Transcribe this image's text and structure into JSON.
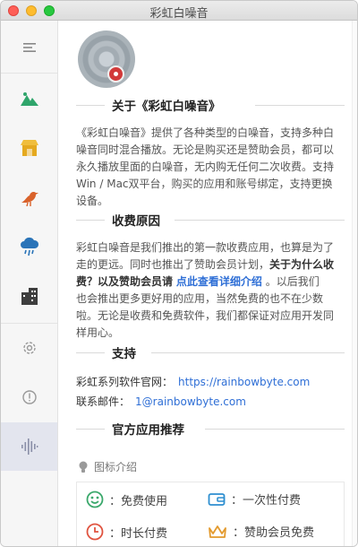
{
  "window": {
    "title": "彩虹白噪音"
  },
  "about": {
    "title": "关于《彩虹白噪音》",
    "lines": [
      "《彩虹白噪音》提供了各种类型的白噪音，支持多种白",
      "噪音同时混合播放。无论是购买还是赞助会员，都可以",
      "永久播放里面的白噪音，无内购无任何二次收费。支持",
      "Win / Mac双平台，购买的应用和账号绑定，支持更换",
      "设备。"
    ]
  },
  "reason": {
    "title": "收费原因",
    "line1": "彩虹白噪音是我们推出的第一款收费应用，也算是为了",
    "line2a": "走的更远。同时也推出了赞助会员计划，",
    "line2b": "关于为什么收",
    "line3a": "费？以及赞助会员请",
    "line3link": "点此查看详细介绍",
    "line3b": "。以后我们",
    "line4": "也会推出更多更好用的应用，当然免费的也不在少数",
    "line5": "啦。无论是收费和免费软件，我们都保证对应用开发同",
    "line6": "样用心。"
  },
  "support": {
    "title": "支持",
    "site_label": "彩虹系列软件官网：",
    "site_url": "https://rainbowbyte.com",
    "email_label": "联系邮件：",
    "email": "1@rainbowbyte.com"
  },
  "recommend": {
    "title": "官方应用推荐",
    "legend_title": "图标介绍",
    "items": [
      {
        "label": "：免费使用",
        "icon": "free-icon",
        "color": "#3aa86b"
      },
      {
        "label": "：一次性付费",
        "icon": "wallet-icon",
        "color": "#2e8fd0"
      },
      {
        "label": "：时长付费",
        "icon": "clock-icon",
        "color": "#e0533f"
      },
      {
        "label": "：赞助会员免费",
        "icon": "crown-icon",
        "color": "#e39a2d"
      }
    ]
  },
  "sidebar": {
    "items": [
      {
        "name": "menu-icon"
      },
      {
        "name": "nature-icon",
        "color": "#2fa56b"
      },
      {
        "name": "shop-icon",
        "color": "#e5a91f"
      },
      {
        "name": "bird-icon",
        "color": "#d9622b"
      },
      {
        "name": "rain-cloud-icon",
        "color": "#2a74b8"
      },
      {
        "name": "city-icon",
        "color": "#3e3e3e"
      },
      {
        "name": "settings-icon"
      },
      {
        "name": "info-icon"
      },
      {
        "name": "sound-wave-icon",
        "active": true
      }
    ]
  }
}
